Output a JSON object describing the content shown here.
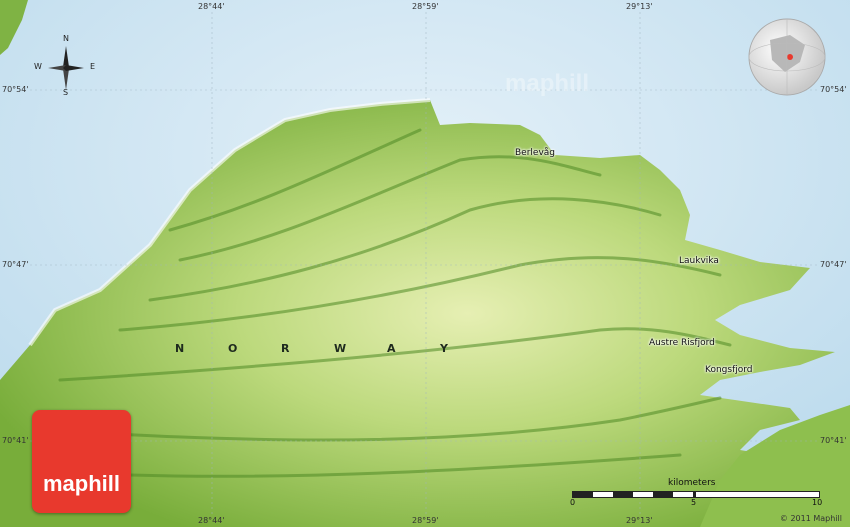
{
  "map": {
    "country": "NORWAY",
    "country_letters": [
      "N",
      "O",
      "R",
      "W",
      "A",
      "Y"
    ],
    "places": [
      {
        "name": "Berlevåg"
      },
      {
        "name": "Laukvika"
      },
      {
        "name": "Austre Risfjord"
      },
      {
        "name": "Kongsfjord"
      }
    ],
    "lon_ticks_top": [
      "28°44'",
      "28°59'",
      "29°13'"
    ],
    "lon_ticks_bottom": [
      "28°44'",
      "28°59'",
      "29°13'"
    ],
    "lat_ticks_left": [
      "70°54'",
      "70°47'",
      "70°41'"
    ],
    "lat_ticks_right": [
      "70°54'",
      "70°47'",
      "70°41'"
    ],
    "compass": {
      "n": "N",
      "s": "S",
      "e": "E",
      "w": "W"
    },
    "scale": {
      "title": "kilometers",
      "labels": [
        "0",
        "5",
        "10"
      ]
    },
    "copyright": "© 2011 Maphill",
    "logo": "maphill",
    "watermark": "maphill",
    "colors": {
      "sea": "#cfe6f3",
      "land": "#9fc95c",
      "logo": "#e8392d"
    }
  }
}
